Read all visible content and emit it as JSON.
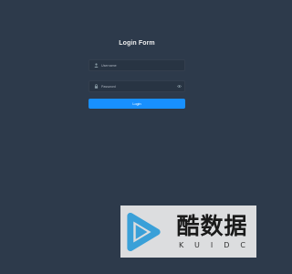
{
  "login": {
    "title": "Login Form",
    "username": {
      "placeholder": "Username",
      "value": "",
      "icon": "user-icon"
    },
    "password": {
      "placeholder": "Password",
      "value": "",
      "icon": "lock-icon",
      "toggle_icon": "eye-icon"
    },
    "submit_label": "Login"
  },
  "watermark": {
    "chinese_text": "酷数据",
    "latin_text": "KUIDC",
    "logo_icon": "play-logo"
  },
  "colors": {
    "background": "#2d3a4b",
    "input_background": "#283443",
    "primary": "#1890ff",
    "title_text": "#eeeeee"
  }
}
